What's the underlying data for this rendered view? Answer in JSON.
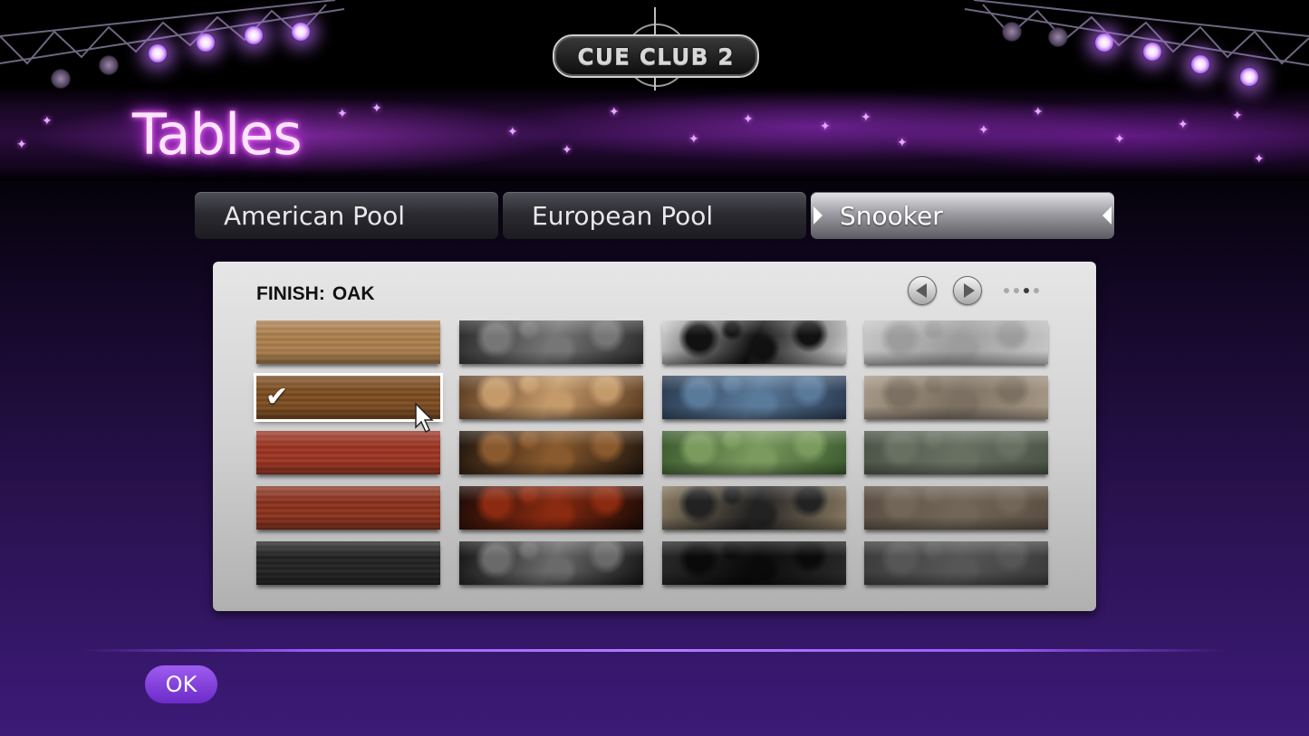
{
  "logo": {
    "text": "CUE CLUB 2"
  },
  "page": {
    "title": "Tables"
  },
  "tabs": [
    {
      "label": "American Pool",
      "active": false
    },
    {
      "label": "European Pool",
      "active": false
    },
    {
      "label": "Snooker",
      "active": true
    }
  ],
  "finish": {
    "label": "FINISH:",
    "value": "OAK"
  },
  "pager": {
    "total_pages": 4,
    "current_page": 3
  },
  "swatches": [
    {
      "name": "light-wood",
      "colors": [
        "#b58a57",
        "#9a7146"
      ]
    },
    {
      "name": "dark-marble",
      "colors": [
        "#2a2a2a",
        "#767676"
      ]
    },
    {
      "name": "black-white-granite",
      "colors": [
        "#d2d2d2",
        "#111111"
      ]
    },
    {
      "name": "light-grey-marble",
      "colors": [
        "#c8c8c8",
        "#9c9c9c"
      ]
    },
    {
      "name": "oak",
      "colors": [
        "#8a5a2a",
        "#6b4220"
      ],
      "selected": true
    },
    {
      "name": "brown-gold-marble",
      "colors": [
        "#5a3a20",
        "#c49a6a"
      ]
    },
    {
      "name": "blue-granite",
      "colors": [
        "#2a3a50",
        "#5a7a9a"
      ]
    },
    {
      "name": "beige-marble",
      "colors": [
        "#a89a88",
        "#7c7062"
      ]
    },
    {
      "name": "red-wood",
      "colors": [
        "#8a2e1c",
        "#a84030"
      ]
    },
    {
      "name": "black-gold-marble",
      "colors": [
        "#1e140c",
        "#8a5a2e"
      ]
    },
    {
      "name": "green-granite",
      "colors": [
        "#3a5a2e",
        "#7a9a5e"
      ]
    },
    {
      "name": "grey-green-marble",
      "colors": [
        "#4a5446",
        "#687062"
      ]
    },
    {
      "name": "mahogany",
      "colors": [
        "#7a2a18",
        "#96402a"
      ]
    },
    {
      "name": "black-red-marble",
      "colors": [
        "#1a0a06",
        "#8a2a10"
      ]
    },
    {
      "name": "tan-granite",
      "colors": [
        "#8a7a62",
        "#222222"
      ]
    },
    {
      "name": "taupe-marble",
      "colors": [
        "#5a4e42",
        "#726658"
      ]
    },
    {
      "name": "black-wood",
      "colors": [
        "#1e1e1e",
        "#2e2e2e"
      ]
    },
    {
      "name": "black-grey-marble",
      "colors": [
        "#141414",
        "#6a6a6a"
      ]
    },
    {
      "name": "black-granite",
      "colors": [
        "#2a2a2a",
        "#0a0a0a"
      ]
    },
    {
      "name": "charcoal-marble",
      "colors": [
        "#3a3a3a",
        "#565656"
      ]
    }
  ],
  "ok_button": {
    "label": "OK"
  }
}
